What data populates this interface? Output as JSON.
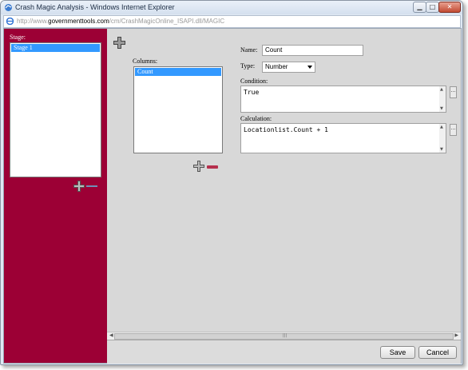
{
  "window": {
    "title": "Crash Magic Analysis - Windows Internet Explorer",
    "url_prefix": "http://www.",
    "url_domain": "governmenttools.com",
    "url_path": "/cm/CrashMagicOnline_ISAPI.dll/MAGIC"
  },
  "stage_panel": {
    "label": "Stage:",
    "items": [
      "Stage 1"
    ]
  },
  "columns_panel": {
    "label": "Columns:",
    "items": [
      "Count"
    ]
  },
  "form": {
    "name_label": "Name:",
    "name_value": "Count",
    "type_label": "Type:",
    "type_value": "Number",
    "condition_label": "Condition:",
    "condition_value": "True",
    "calculation_label": "Calculation:",
    "calculation_value": "Locationlist.Count + 1",
    "ellipsis": "..."
  },
  "footer": {
    "save_label": "Save",
    "cancel_label": "Cancel"
  },
  "colors": {
    "panel_red": "#9c0035",
    "selection_blue": "#3399ff"
  }
}
